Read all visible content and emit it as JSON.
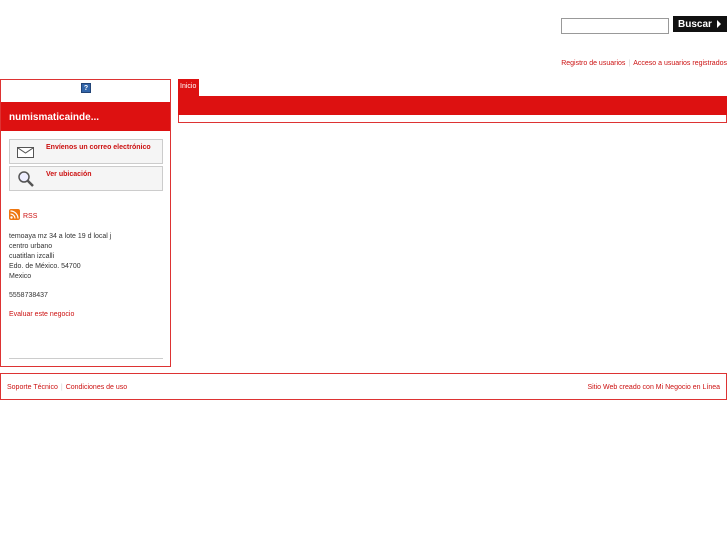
{
  "header": {
    "search_value": "",
    "search_button_label": "Buscar"
  },
  "user_links": {
    "register": "Registro de usuarios",
    "login": "Acceso a usuarios registrados"
  },
  "sidebar": {
    "help_symbol": "?",
    "business_name": "numismaticainde...",
    "email_action": "Envíenos un correo electrónico",
    "map_action": "Ver ubicación",
    "rss_label": "RSS",
    "address": {
      "line1": "temoaya mz 34 a lote 19 d local j",
      "line2": "centro urbano",
      "line3": "cuatitlan izcalli",
      "line4": "Edo. de México. 54700",
      "line5": "Mexico"
    },
    "phone": "5558738437",
    "rate_link": "Evaluar este negocio"
  },
  "main": {
    "tab_label": "Inicio"
  },
  "footer": {
    "support": "Soporte Técnico",
    "terms": "Condiciones de uso",
    "credit": "Sitio Web creado con Mi Negocio en Línea"
  },
  "colors": {
    "accent_red": "#dd1111",
    "link_red": "#cc1111"
  }
}
